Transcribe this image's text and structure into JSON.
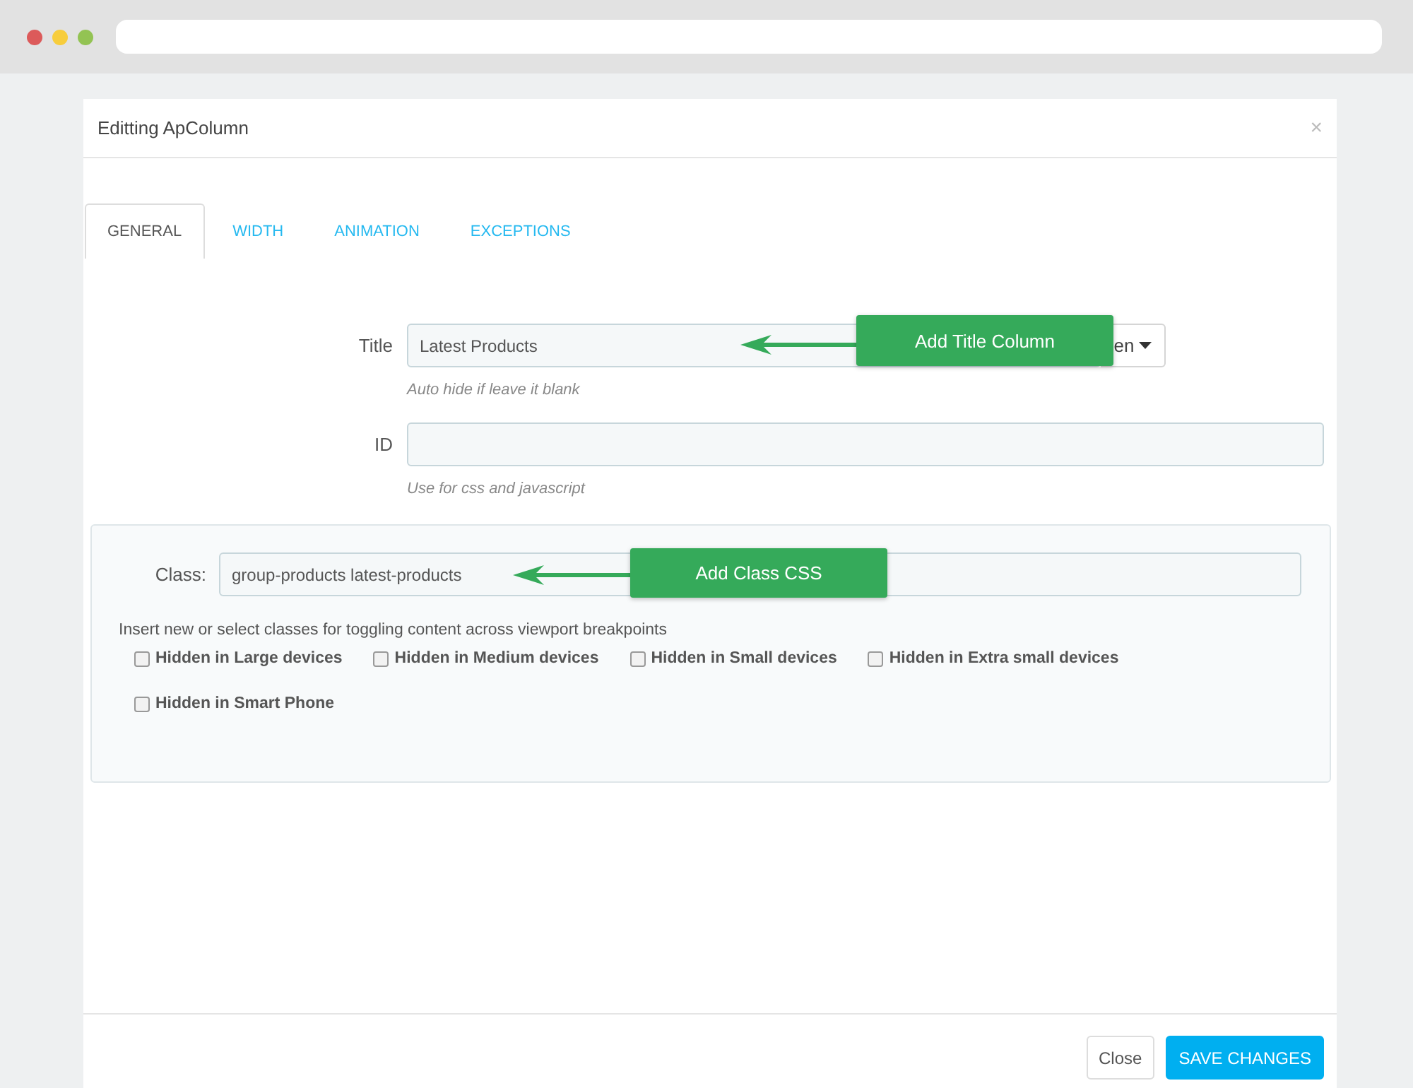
{
  "dialog": {
    "title": "Editting ApColumn",
    "close": "×"
  },
  "tabs": [
    {
      "label": "GENERAL",
      "selected": true
    },
    {
      "label": "WIDTH",
      "selected": false
    },
    {
      "label": "ANIMATION",
      "selected": false
    },
    {
      "label": "EXCEPTIONS",
      "selected": false
    }
  ],
  "fields": [
    {
      "label": "Title",
      "value": "Latest Products",
      "language": "en",
      "hint": "Auto hide if leave it blank",
      "callout": "Add Title Column"
    },
    {
      "label": "ID",
      "hint": "Use for css and javascript"
    }
  ],
  "class_panel": {
    "label": "Class:",
    "value": "group-products latest-products",
    "callout": "Add Class CSS",
    "help": "Insert new or select classes for toggling content across viewport breakpoints",
    "options": [
      {
        "label": "Hidden in Large devices",
        "checked": false
      },
      {
        "label": "Hidden in Medium devices",
        "checked": false
      },
      {
        "label": "Hidden in Small devices",
        "checked": false
      },
      {
        "label": "Hidden in Extra small devices",
        "checked": false
      },
      {
        "label": "Hidden in Smart Phone",
        "checked": false
      }
    ]
  },
  "buttons": [
    {
      "label": "Close",
      "kind": "default"
    },
    {
      "label": "SAVE CHANGES",
      "kind": "primary"
    }
  ]
}
